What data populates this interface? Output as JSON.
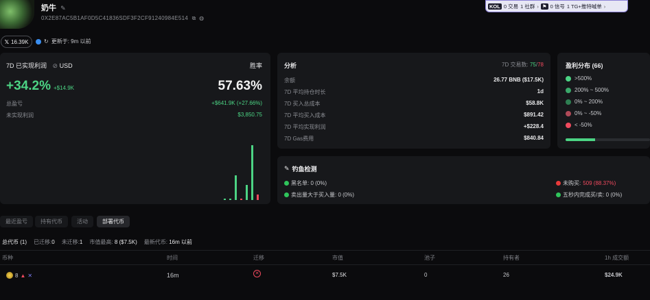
{
  "profile": {
    "name": "奶牛",
    "address": "0X2E87AC5B1AF0D5C41836SDF3F2CF91240984E514",
    "followers": "16.39K",
    "updated": "更新于: 9m 以前"
  },
  "kol_banner": {
    "tag": "KOL",
    "trades": "0 交易",
    "community": "1 社群",
    "signal": "0 信号",
    "tg": "1 TG+推特喊单"
  },
  "pnl_card": {
    "title": "7D 已实现利润",
    "currency": "USD",
    "winrate_label": "胜率",
    "pnl_pct": "+34.2%",
    "pnl_usd": "+$14.9K",
    "winrate": "57.63%",
    "total_label": "总盈亏",
    "total_value": "+$641.9K (+27.66%)",
    "unrealized_label": "未实现利润",
    "unrealized_value": "$3,850.75",
    "bars": [
      {
        "value": 0.02,
        "color": "#4cd484"
      },
      {
        "value": 0.02,
        "color": "#4cd484"
      },
      {
        "value": 0.45,
        "color": "#4cd484"
      },
      {
        "value": 0.02,
        "color": "#f04a5e"
      },
      {
        "value": 0.28,
        "color": "#4cd484"
      },
      {
        "value": 1.0,
        "color": "#4cd484"
      },
      {
        "value": 0.1,
        "color": "#f04a5e"
      }
    ]
  },
  "analysis": {
    "title": "分析",
    "trades_label": "7D 交易数:",
    "trades_win": "75",
    "trades_total": "78",
    "rows": [
      {
        "label": "余额",
        "value": "26.77 BNB ($17.5K)",
        "green": false
      },
      {
        "label": "7D 平均持仓时长",
        "value": "1d",
        "green": false
      },
      {
        "label": "7D 买入总成本",
        "value": "$58.8K",
        "green": false
      },
      {
        "label": "7D 平均买入成本",
        "value": "$891.42",
        "green": false
      },
      {
        "label": "7D 平均实现利润",
        "value": "+$228.4",
        "green": true
      },
      {
        "label": "7D Gas费用",
        "value": "$840.84",
        "green": false
      }
    ]
  },
  "distribution": {
    "title": "盈利分布 (66)",
    "items": [
      {
        "label": ">500%",
        "color": "#4cd484"
      },
      {
        "label": "200% ~ 500%",
        "color": "#3aa86a"
      },
      {
        "label": "0% ~ 200%",
        "color": "#2e7f52"
      },
      {
        "label": "0% ~ -50%",
        "color": "#b04a58"
      },
      {
        "label": "< -50%",
        "color": "#f04a5e"
      }
    ],
    "bar_share": 0.35
  },
  "phishing": {
    "title": "钓鱼检测",
    "blacklist": "黑名单: 0 (0%)",
    "sell_gt_buy": "卖出量大于买入量: 0 (0%)",
    "no_buy_label": "未购买:",
    "no_buy_value": "509 (88.37%)",
    "five_sec": "五秒内完成买/卖: 0 (0%)"
  },
  "tabs": [
    "最近盈亏",
    "持有代币",
    "活动",
    "部署代币"
  ],
  "summary": {
    "total": "总代币 (1)",
    "migrated_label": "已迁移:",
    "migrated": "0",
    "unmigrated_label": "未迁移:",
    "unmigrated": "1",
    "mc_label": "市值最高:",
    "mc": "8 ($7.5K)",
    "latest_label": "最新代币:",
    "latest": "16m 以前"
  },
  "table": {
    "headers": [
      "币种",
      "时间",
      "迁移",
      "市值",
      "池子",
      "持有者",
      "1h 成交额"
    ],
    "row": {
      "token": "8",
      "time": "16m",
      "mcap": "$7.5K",
      "pool": "0",
      "holders": "26",
      "volume": "$24.9K"
    }
  }
}
